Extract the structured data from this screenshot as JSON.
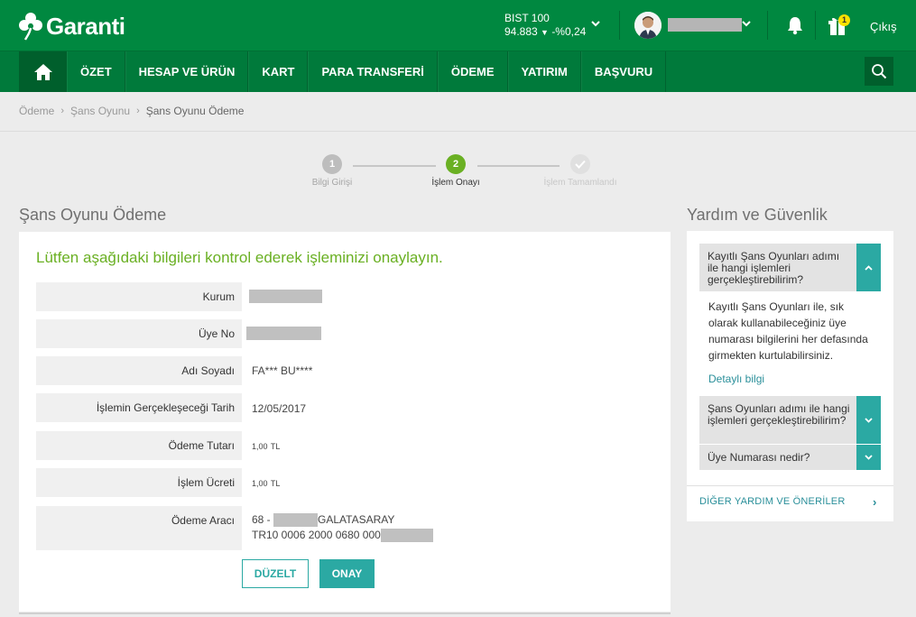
{
  "header": {
    "logo_text": "Garanti",
    "bist_label": "BIST 100",
    "bist_value": "94.883",
    "bist_change": "-%0,24",
    "notification_count": "1",
    "logout_label": "Çıkış"
  },
  "nav": {
    "items": [
      {
        "label": "ÖZET"
      },
      {
        "label": "HESAP VE ÜRÜN"
      },
      {
        "label": "KART"
      },
      {
        "label": "PARA TRANSFERİ"
      },
      {
        "label": "ÖDEME"
      },
      {
        "label": "YATIRIM"
      },
      {
        "label": "BAŞVURU"
      }
    ]
  },
  "breadcrumb": {
    "items": [
      "Ödeme",
      "Şans Oyunu",
      "Şans Oyunu Ödeme"
    ]
  },
  "stepper": {
    "steps": [
      {
        "number": "1",
        "label": "Bilgi Girişi"
      },
      {
        "number": "2",
        "label": "İşlem Onayı"
      },
      {
        "number": "",
        "label": "İşlem Tamamlandı"
      }
    ]
  },
  "main": {
    "title": "Şans Oyunu Ödeme",
    "heading": "Lütfen aşağıdaki bilgileri kontrol ederek işleminizi onaylayın.",
    "rows": {
      "kurum_label": "Kurum",
      "uye_label": "Üye No",
      "ad_label": "Adı Soyadı",
      "ad_value": "FA*** BU****",
      "tarih_label": "İşlemin Gerçekleşeceği Tarih",
      "tarih_value": "12/05/2017",
      "tutar_label": "Ödeme Tutarı",
      "tutar_value": "1,00",
      "tutar_currency": "TL",
      "ucret_label": "İşlem Ücreti",
      "ucret_value": "1,00",
      "ucret_currency": "TL",
      "arac_label": "Ödeme Aracı",
      "arac_line1_prefix": "68 - ",
      "arac_line1_suffix": "GALATASARAY",
      "arac_line2_prefix": "TR10 0006 2000 0680 000"
    },
    "edit_button": "DÜZELT",
    "confirm_button": "ONAY"
  },
  "help": {
    "title": "Yardım ve Güvenlik",
    "q1": "Kayıtlı Şans Oyunları adımı ile hangi işlemleri gerçekleştirebilirim?",
    "a1": "Kayıtlı Şans Oyunları ile, sık olarak kullanabileceğiniz üye numarası bilgilerini her defasında girmekten kurtulabilirsiniz.",
    "details_link": "Detaylı bilgi",
    "q2": "Şans Oyunları adımı ile hangi işlemleri gerçekleştirebilirim?",
    "q3": "Üye Numarası nedir?",
    "more_link": "DİĞER YARDIM VE ÖNERİLER"
  },
  "colors": {
    "brand_green": "#008840",
    "nav_green": "#007a3b",
    "accent_teal": "#2ba9a3",
    "heading_green": "#6ab023"
  }
}
